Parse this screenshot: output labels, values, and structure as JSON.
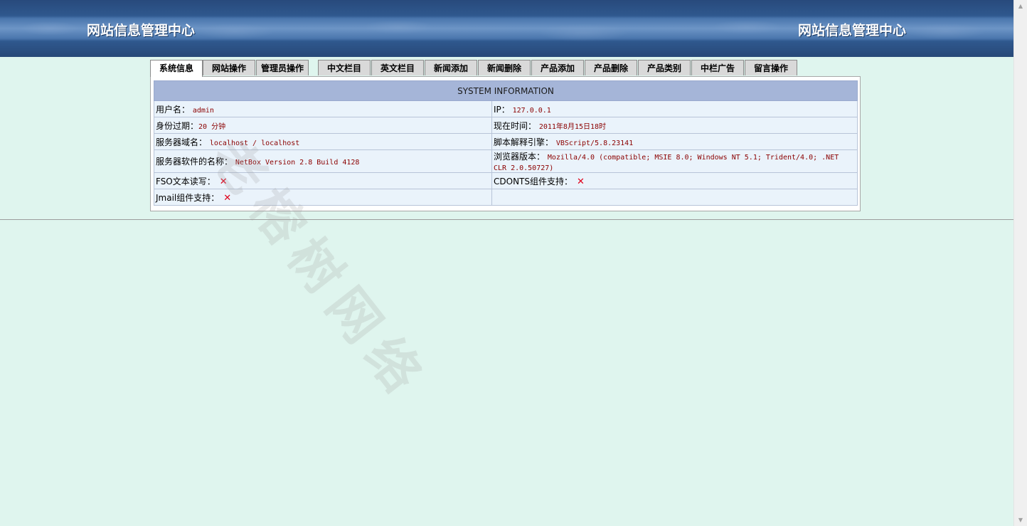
{
  "header": {
    "title_left": "网站信息管理中心",
    "title_right": "网站信息管理中心"
  },
  "tabs": [
    {
      "label": "系统信息",
      "active": true
    },
    {
      "label": "网站操作"
    },
    {
      "label": "管理员操作"
    },
    {
      "label": "中文栏目"
    },
    {
      "label": "英文栏目"
    },
    {
      "label": "新闻添加"
    },
    {
      "label": "新闻删除"
    },
    {
      "label": "产品添加"
    },
    {
      "label": "产品删除"
    },
    {
      "label": "产品类别"
    },
    {
      "label": "中栏广告"
    },
    {
      "label": "留言操作"
    }
  ],
  "info": {
    "heading": "SYSTEM INFORMATION",
    "username_label": "用户名：",
    "username_value": "admin",
    "ip_label": "IP：",
    "ip_value": "127.0.0.1",
    "expiry_label": "身份过期：",
    "expiry_value": "20 分钟",
    "time_label": "现在时间：",
    "time_value": "2011年8月15日18时",
    "domain_label": "服务器域名：",
    "domain_value": "localhost / localhost",
    "script_label": "脚本解释引擎：",
    "script_value": "VBScript/5.8.23141",
    "software_label": "服务器软件的名称：",
    "software_value": "NetBox Version 2.8 Build 4128",
    "browser_label": "浏览器版本：",
    "browser_value": "Mozilla/4.0 (compatible; MSIE 8.0; Windows NT 5.1; Trident/4.0; .NET CLR 2.0.50727)",
    "fso_label": "FSO文本读写：",
    "fso_value": "✕",
    "cdonts_label": "CDONTS组件支持：",
    "cdonts_value": "✕",
    "jmail_label": "Jmail组件支持：",
    "jmail_value": "✕"
  },
  "watermark": "老榕树网络",
  "colors": {
    "background": "#dff5ee",
    "header": "#2a5083",
    "table_heading": "#a5b5d8",
    "value_text": "#8b0000",
    "unsupported_mark": "#e0001a"
  }
}
